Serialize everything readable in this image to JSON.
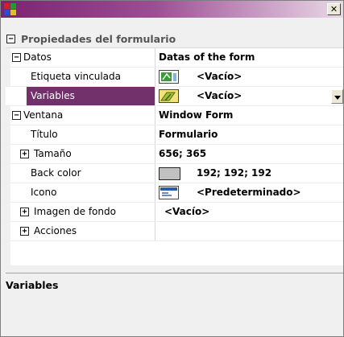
{
  "window": {
    "title": "",
    "close_glyph": "✕"
  },
  "grid": {
    "category": "Propiedades del formulario",
    "rows": [
      {
        "name": "Datos",
        "value": "Datas of the form"
      },
      {
        "name": "Etiqueta vinculada",
        "value": "<Vacío>"
      },
      {
        "name": "Variables",
        "value": "<Vacío>"
      },
      {
        "name": "Ventana",
        "value": "Window Form"
      },
      {
        "name": "Título",
        "value": "Formulario"
      },
      {
        "name": "Tamaño",
        "value": "656; 365"
      },
      {
        "name": "Back color",
        "value": "192; 192; 192"
      },
      {
        "name": "Icono",
        "value": "<Predeterminado>"
      },
      {
        "name": "Imagen de fondo",
        "value": "<Vacío>"
      },
      {
        "name": "Acciones",
        "value": ""
      }
    ],
    "expanders": {
      "minus": "−",
      "plus": "+"
    },
    "back_color_swatch": "#c0c0c0",
    "selected_color": "#73316c"
  },
  "description": {
    "title": "Variables"
  }
}
